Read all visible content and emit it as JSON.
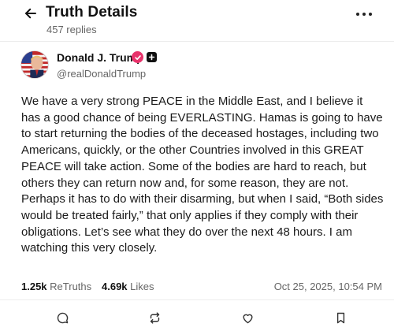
{
  "header": {
    "title": "Truth Details",
    "subtitle": "457 replies"
  },
  "post": {
    "author_name": "Donald J. Trump",
    "handle": "@realDonaldTrump",
    "text": "We have a very strong PEACE in the Middle East, and I believe it has a good chance of being EVERLASTING. Hamas is going to have to start returning the bodies of the deceased hostages, including two Americans, quickly, or the other Countries involved in this GREAT PEACE will take action. Some of the bodies are hard to reach, but others they can return now and, for some reason, they are not. Perhaps it has to do with their disarming, but when I said, “Both sides would be treated fairly,” that only applies if they comply with their obligations. Let’s see what they do over the next 48 hours. I am watching this very closely.",
    "retruths_count": "1.25k",
    "retruths_label": "ReTruths",
    "likes_count": "4.69k",
    "likes_label": "Likes",
    "timestamp": "Oct 25, 2025, 10:54 PM"
  },
  "icons": {
    "back": "arrow-left-icon",
    "more": "more-horizontal-icon",
    "verified": "verified-badge-icon",
    "badge": "plus-badge-icon",
    "reply": "comment-icon",
    "retruth": "repost-icon",
    "like": "heart-icon",
    "bookmark": "bookmark-icon"
  },
  "colors": {
    "verified": "#e8336b",
    "text": "#1a1a1a",
    "muted": "#666666",
    "divider": "#ececec"
  }
}
